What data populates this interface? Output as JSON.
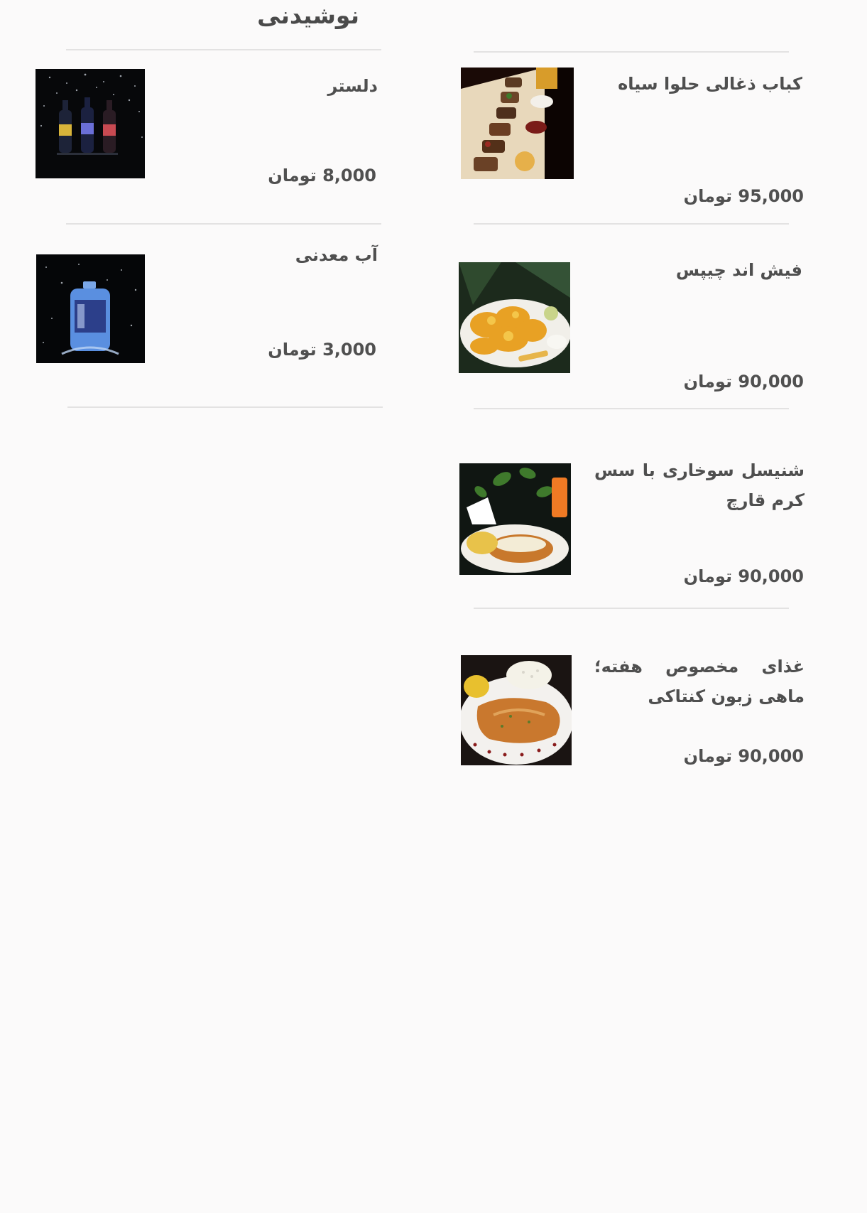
{
  "left_column": {
    "title": "نوشیدنی",
    "items": [
      {
        "name": "دلستر",
        "price": "8,000 تومان",
        "image_icon": "beer-bottles-image"
      },
      {
        "name": "آب معدنی",
        "price": "3,000 تومان",
        "image_icon": "water-bottle-image"
      }
    ]
  },
  "right_column": {
    "items": [
      {
        "name": "کباب ذغالی حلوا سیاه",
        "price": "95,000 تومان",
        "image_icon": "kebab-platter-image"
      },
      {
        "name": "فیش اند چیپس",
        "price": "90,000 تومان",
        "image_icon": "fish-and-chips-image"
      },
      {
        "name": "شنیسل سوخاری با سس کرم قارچ",
        "price": "90,000 تومان",
        "image_icon": "schnitzel-plate-image"
      },
      {
        "name": "غذای مخصوص هفته؛ ماهی زبون کنتاکی",
        "price": "90,000 تومان",
        "image_icon": "fried-fish-plate-image"
      }
    ]
  }
}
